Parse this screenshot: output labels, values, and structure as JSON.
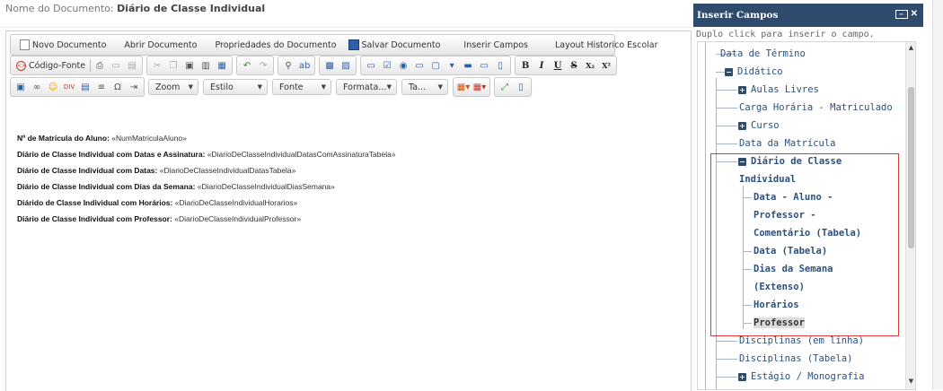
{
  "document": {
    "title_label": "Nome do Documento: ",
    "title_value": "Diário de Classe Individual"
  },
  "toolbar1": {
    "novo": "Novo Documento",
    "abrir": "Abrir Documento",
    "propriedades": "Propriedades do Documento",
    "salvar": "Salvar Documento",
    "inserir": "Inserir Campos",
    "layout": "Layout Historico Escolar"
  },
  "toolbar2": {
    "source": "Código-Fonte",
    "bold": "B",
    "italic": "I",
    "underline": "U",
    "strike": "S",
    "subscript": "X₂",
    "superscript": "X²"
  },
  "toolbar3": {
    "omega": "Ω",
    "zoom": "Zoom",
    "estilo": "Estilo",
    "fonte": "Fonte",
    "formato": "Formata...",
    "tamanho": "Ta..."
  },
  "content": [
    {
      "label": "Nº de Matrícula do Aluno:",
      "field": " «NumMatriculaAluno»"
    },
    {
      "label": "Diário de Classe Individual com Datas e Assinatura:",
      "field": "  «DiarioDeClasseIndividualDatasComAssinaturaTabela»"
    },
    {
      "label": "Diário de Classe Individual com Datas:",
      "field": " «DiarioDeClasseIndividualDatasTabela»"
    },
    {
      "label": "Diário de Classe Individual com Dias da Semana:",
      "field": " «DiarioDeClasseIndividualDiasSemana»"
    },
    {
      "label": "Diárido de Classe Individual com Horários:",
      "field": " «DiarioDeClasseIndividualHorarios»"
    },
    {
      "label": "Diário de Classe Individual com Professor:",
      "field": " «DiarioDeClasseIndividualProfessor»"
    }
  ],
  "panel": {
    "title": "Inserir Campos",
    "hint": "Duplo click para inserir o campo.",
    "tree": {
      "data_termino": "Data de Término",
      "didatico": "Didático",
      "aulas_livres": "Aulas Livres",
      "carga_horaria": "Carga Horária - Matriculado",
      "curso": "Curso",
      "data_matricula": "Data da Matrícula",
      "diario_1": "Diário de Classe",
      "diario_2": "Individual",
      "dap_1": "Data - Aluno -",
      "dap_2": "Professor -",
      "dap_3": "Comentário (Tabela)",
      "data_tabela": "Data (Tabela)",
      "dias_1": "Dias da Semana",
      "dias_2": "(Extenso)",
      "horarios": "Horários",
      "professor": "Professor",
      "disc_linha": "Disciplinas (em linha)",
      "disc_tabela": "Disciplinas (Tabela)",
      "estagio": "Estágio / Monografia"
    }
  },
  "colors": {
    "panel_header": "#2e4a6d",
    "tree_text": "#2b4f80",
    "highlight": "#d63b3b"
  }
}
